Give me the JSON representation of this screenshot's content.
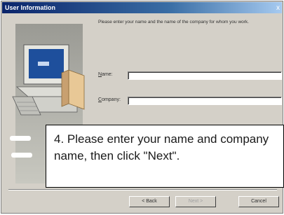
{
  "window": {
    "title": "User Information",
    "close_symbol": "x"
  },
  "dialog": {
    "prompt": "Please enter your name and the name of the company for whom you work.",
    "name_label_accel": "N",
    "name_label_rest": "ame:",
    "name_value": "",
    "company_label_accel": "C",
    "company_label_rest": "ompany:",
    "company_value": ""
  },
  "buttons": {
    "back": "< Back",
    "next": "Next >",
    "cancel": "Cancel"
  },
  "callout": {
    "text": "4. Please enter your name and company name, then click \"Next\"."
  },
  "icons": {
    "illustration": "computer-with-install-disks-icon"
  }
}
